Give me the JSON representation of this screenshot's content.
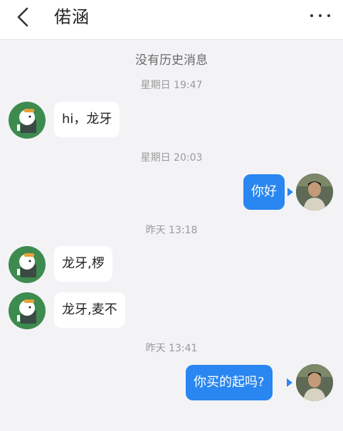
{
  "header": {
    "title": "偌涵",
    "back_icon": "chevron-left-icon",
    "more_icon": "more-horizontal-icon"
  },
  "chat": {
    "no_history": "没有历史消息",
    "timestamps": [
      "星期日 19:47",
      "星期日 20:03",
      "昨天 13:18",
      "昨天 13:41"
    ],
    "messages": [
      {
        "side": "left",
        "text": "hi，龙牙"
      },
      {
        "side": "right",
        "text": "你好"
      },
      {
        "side": "left",
        "text": "龙牙,椤"
      },
      {
        "side": "left",
        "text": "龙牙,麦不"
      },
      {
        "side": "right",
        "text": "你买的起吗?"
      }
    ]
  },
  "colors": {
    "background": "#f3f3f6",
    "outgoing_bubble": "#2a86f0",
    "incoming_bubble": "#ffffff",
    "dog_avatar_bg": "#3d8b4e"
  }
}
